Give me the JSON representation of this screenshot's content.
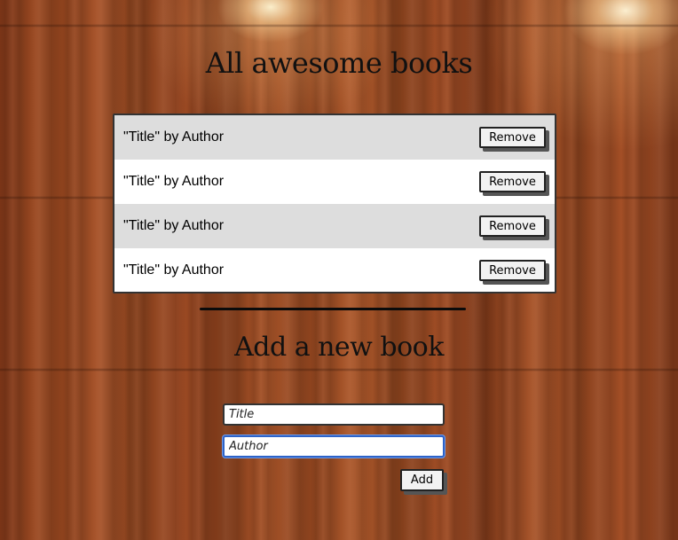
{
  "header": {
    "title": "All awesome books"
  },
  "books": [
    {
      "text": "\"Title\" by Author",
      "remove_label": "Remove"
    },
    {
      "text": "\"Title\" by Author",
      "remove_label": "Remove"
    },
    {
      "text": "\"Title\" by Author",
      "remove_label": "Remove"
    },
    {
      "text": "\"Title\" by Author",
      "remove_label": "Remove"
    }
  ],
  "add_form": {
    "title": "Add a new book",
    "title_field": {
      "placeholder": "Title",
      "value": ""
    },
    "author_field": {
      "placeholder": "Author",
      "value": "",
      "focused": true
    },
    "add_label": "Add"
  },
  "colors": {
    "row_alt": "#dddddd",
    "row_plain": "#ffffff",
    "focus_border": "#2d63c8"
  }
}
